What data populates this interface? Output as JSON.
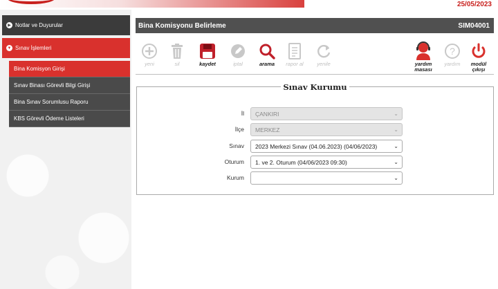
{
  "header": {
    "date": "25/05/2023"
  },
  "sidebar": {
    "sections": [
      {
        "label": "Notlar ve Duyurular"
      },
      {
        "label": "Sınav İşlemleri"
      }
    ],
    "items": [
      {
        "label": "Bina Komisyon Girişi"
      },
      {
        "label": "Sınav Binası Görevli Bilgi Girişi"
      },
      {
        "label": "Bina Sınav Sorumlusu Raporu"
      },
      {
        "label": "KBS Görevli Ödeme Listeleri"
      }
    ]
  },
  "page": {
    "title": "Bina Komisyonu Belirleme",
    "code": "SIM04001"
  },
  "toolbar": {
    "yeni": "yeni",
    "sil": "sil",
    "kaydet": "kaydet",
    "iptal": "iptal",
    "arama": "arama",
    "rapor_al": "rapor al",
    "yenile": "yenile",
    "yardim_masasi_1": "yardım",
    "yardim_masasi_2": "masası",
    "yardim": "yardım",
    "modul_cikisi_1": "modül",
    "modul_cikisi_2": "çıkışı"
  },
  "form": {
    "title": "Sınav Kurumu",
    "il": {
      "label": "İl",
      "value": "ÇANKIRI"
    },
    "ilce": {
      "label": "İlçe",
      "value": "MERKEZ"
    },
    "sinav": {
      "label": "Sınav",
      "value": "2023 Merkezi Sınav (04.06.2023) (04/06/2023)"
    },
    "oturum": {
      "label": "Oturum",
      "value": "1. ve 2. Oturum (04/06/2023 09:30)"
    },
    "kurum": {
      "label": "Kurum",
      "value": ""
    }
  },
  "colors": {
    "accent": "#d9312d",
    "dark": "#505050",
    "disabled": "#e4e4e4"
  }
}
